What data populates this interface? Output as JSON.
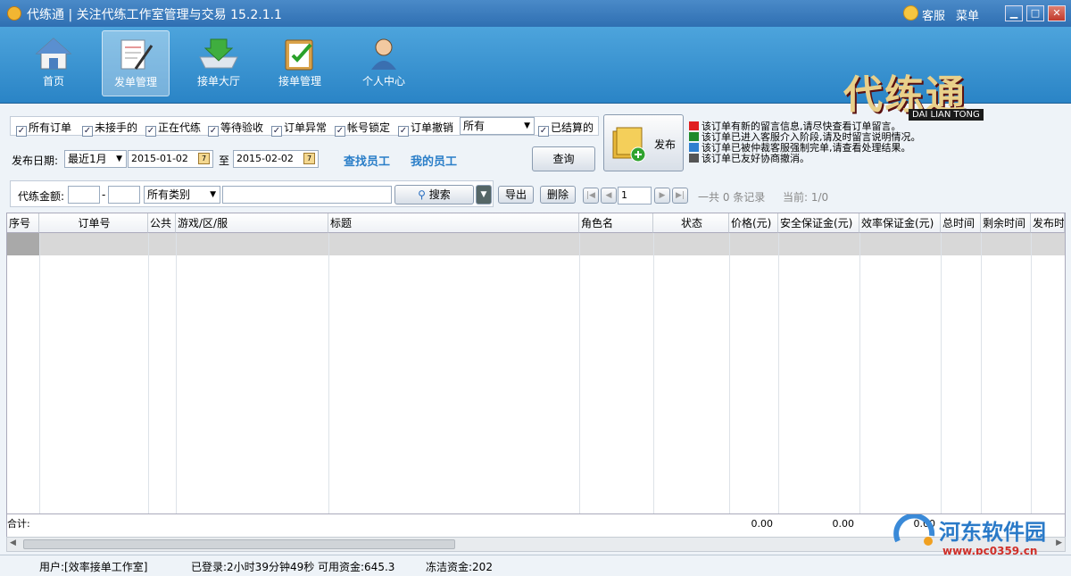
{
  "window": {
    "title": "代练通 | 关注代练工作室管理与交易 15.2.1.1",
    "support_label": "客服",
    "menu_label": "菜单",
    "min_glyph": "▁",
    "max_glyph": "□",
    "close_glyph": "✕"
  },
  "nav": {
    "items": [
      {
        "label": "首页",
        "icon": "home-icon"
      },
      {
        "label": "发单管理",
        "icon": "order-publish-icon"
      },
      {
        "label": "接单大厅",
        "icon": "download-icon"
      },
      {
        "label": "接单管理",
        "icon": "clipboard-icon"
      },
      {
        "label": "个人中心",
        "icon": "user-icon"
      }
    ],
    "active_index": 1
  },
  "logo": {
    "text": "代练通",
    "subtitle": "DAI LIAN TONG"
  },
  "filters": {
    "checkboxes": [
      {
        "label": "所有订单",
        "checked": true
      },
      {
        "label": "未接手的",
        "checked": true
      },
      {
        "label": "正在代练",
        "checked": true
      },
      {
        "label": "等待验收",
        "checked": true
      },
      {
        "label": "订单异常",
        "checked": true
      },
      {
        "label": "帐号锁定",
        "checked": true
      },
      {
        "label": "订单撤销",
        "checked": true
      }
    ],
    "status_select": "所有",
    "settled": {
      "label": "已结算的",
      "checked": true
    },
    "date_label": "发布日期:",
    "range_select": "最近1月",
    "date_from": "2015-01-02",
    "date_to_label": "至",
    "date_to": "2015-02-02",
    "find_staff_link": "查找员工",
    "my_staff_link": "我的员工",
    "query_button": "查询",
    "publish_button": "发布",
    "amount_label": "代练金额:",
    "amount_sep": "-",
    "category_select": "所有类别",
    "search_button": "搜索",
    "export_button": "导出",
    "delete_button": "删除",
    "page_value": "1",
    "total_text": "一共 0 条记录",
    "current_text": "当前: 1/0"
  },
  "legend": [
    {
      "color": "#e02020",
      "text": "该订单有新的留言信息,请尽快查看订单留言。"
    },
    {
      "color": "#1f8a2a",
      "text": "该订单已进入客服介入阶段,请及时留言说明情况。"
    },
    {
      "color": "#2f7fd0",
      "text": "该订单已被仲裁客服强制完单,请查看处理结果。"
    },
    {
      "color": "#555555",
      "text": "该订单已友好协商撤消。"
    }
  ],
  "table": {
    "columns": [
      "序号",
      "订单号",
      "公共",
      "游戏/区/服",
      "标题",
      "角色名",
      "状态",
      "价格(元)",
      "安全保证金(元)",
      "效率保证金(元)",
      "总时间",
      "剩余时间",
      "发布时"
    ],
    "summary_label": "合计:",
    "summary_price": "0.00",
    "summary_security": "0.00",
    "summary_efficiency": "0.00"
  },
  "status": {
    "user": "用户:[效率接单工作室]",
    "login": "已登录:2小时39分钟49秒",
    "funds": "可用资金:645.3",
    "frozen": "冻洁资金:202"
  },
  "watermark": {
    "name": "河东软件园",
    "url": "www.pc0359.cn"
  }
}
